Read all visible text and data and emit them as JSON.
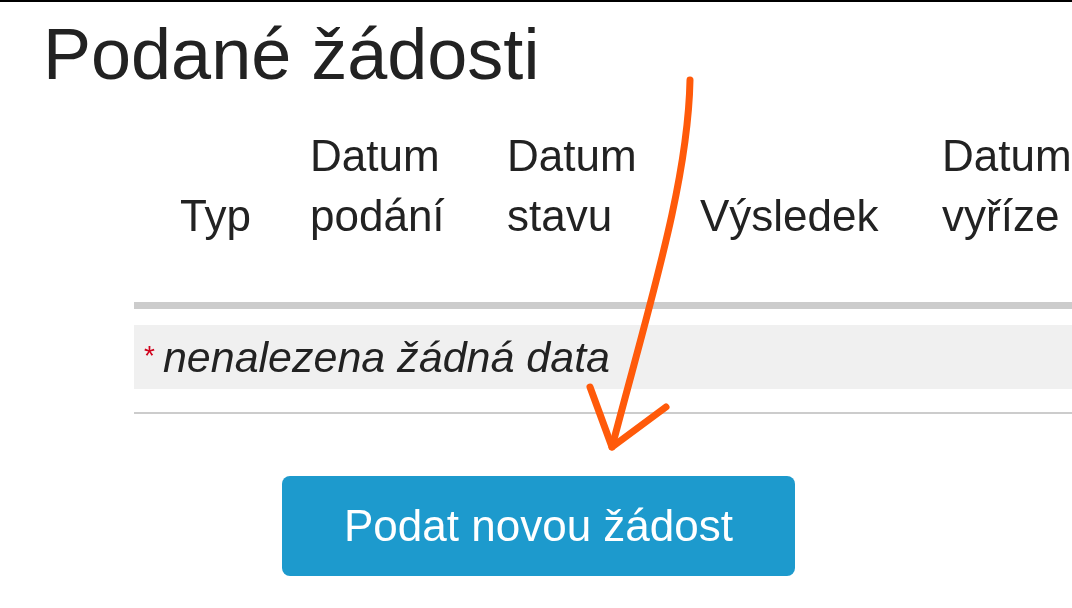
{
  "title": "Podané žádosti",
  "table": {
    "columns": [
      {
        "lines": [
          "Typ"
        ]
      },
      {
        "lines": [
          "Datum",
          "podání"
        ]
      },
      {
        "lines": [
          "Datum",
          "stavu"
        ]
      },
      {
        "lines": [
          "Výsledek"
        ]
      },
      {
        "lines": [
          "Datum",
          "vyříze"
        ]
      }
    ],
    "empty_row": {
      "mark": "*",
      "text": "nenalezena žádná data"
    }
  },
  "button": {
    "label": "Podat novou žádost"
  }
}
